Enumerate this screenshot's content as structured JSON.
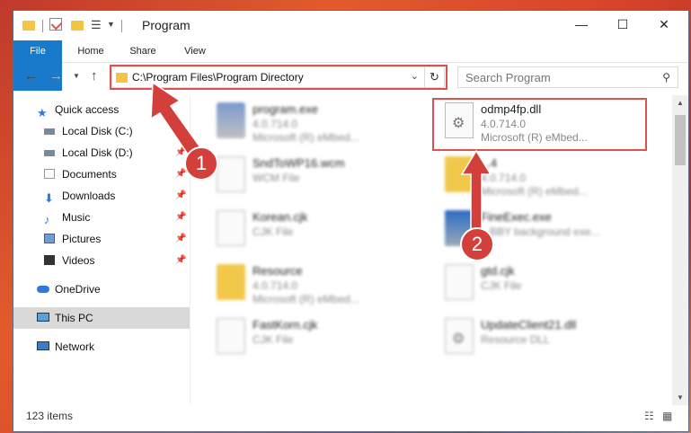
{
  "titlebar": {
    "title": "Program",
    "minimize": "—",
    "maximize": "☐",
    "close": "✕"
  },
  "ribbon": {
    "tabs": [
      "File",
      "Home",
      "Share",
      "View"
    ]
  },
  "address": {
    "path": "C:\\Program Files\\Program Directory"
  },
  "search": {
    "placeholder": "Search Program"
  },
  "sidebar": {
    "items": [
      {
        "label": "Quick access",
        "icon": "star-icon"
      },
      {
        "label": "Local Disk (C:)",
        "icon": "drive-icon"
      },
      {
        "label": "Local Disk (D:)",
        "icon": "drive-icon"
      },
      {
        "label": "Documents",
        "icon": "documents-icon"
      },
      {
        "label": "Downloads",
        "icon": "download-icon"
      },
      {
        "label": "Music",
        "icon": "music-icon"
      },
      {
        "label": "Pictures",
        "icon": "pictures-icon"
      },
      {
        "label": "Videos",
        "icon": "videos-icon"
      },
      {
        "label": "OneDrive",
        "icon": "cloud-icon"
      },
      {
        "label": "This PC",
        "icon": "computer-icon"
      },
      {
        "label": "Network",
        "icon": "network-icon"
      }
    ]
  },
  "files": [
    {
      "name": "program.exe",
      "line2": "4.0.714.0",
      "line3": "Microsoft (R) eMbed..."
    },
    {
      "name": "odmp4fp.dll",
      "line2": "4.0.714.0",
      "line3": "Microsoft (R) eMbed..."
    },
    {
      "name": "SndToWP16.wcm",
      "line2": "WCM File",
      "line3": ""
    },
    {
      "name": "...4",
      "line2": "4.0.714.0",
      "line3": "Microsoft (R) eMbed..."
    },
    {
      "name": "Korean.cjk",
      "line2": "CJK File",
      "line3": ""
    },
    {
      "name": "FineExec.exe",
      "line2": "...BBY background exe...",
      "line3": ""
    },
    {
      "name": "Resource",
      "line2": "4.0.714.0",
      "line3": "Microsoft (R) eMbed..."
    },
    {
      "name": "gtd.cjk",
      "line2": "CJK File",
      "line3": ""
    },
    {
      "name": "FastKorn.cjk",
      "line2": "CJK File",
      "line3": ""
    },
    {
      "name": "UpdateClient21.dll",
      "line2": "Resource DLL",
      "line3": ""
    }
  ],
  "status": {
    "count": "123 items"
  },
  "annotations": {
    "badge1": "1",
    "badge2": "2",
    "color": "#d33f3a"
  }
}
